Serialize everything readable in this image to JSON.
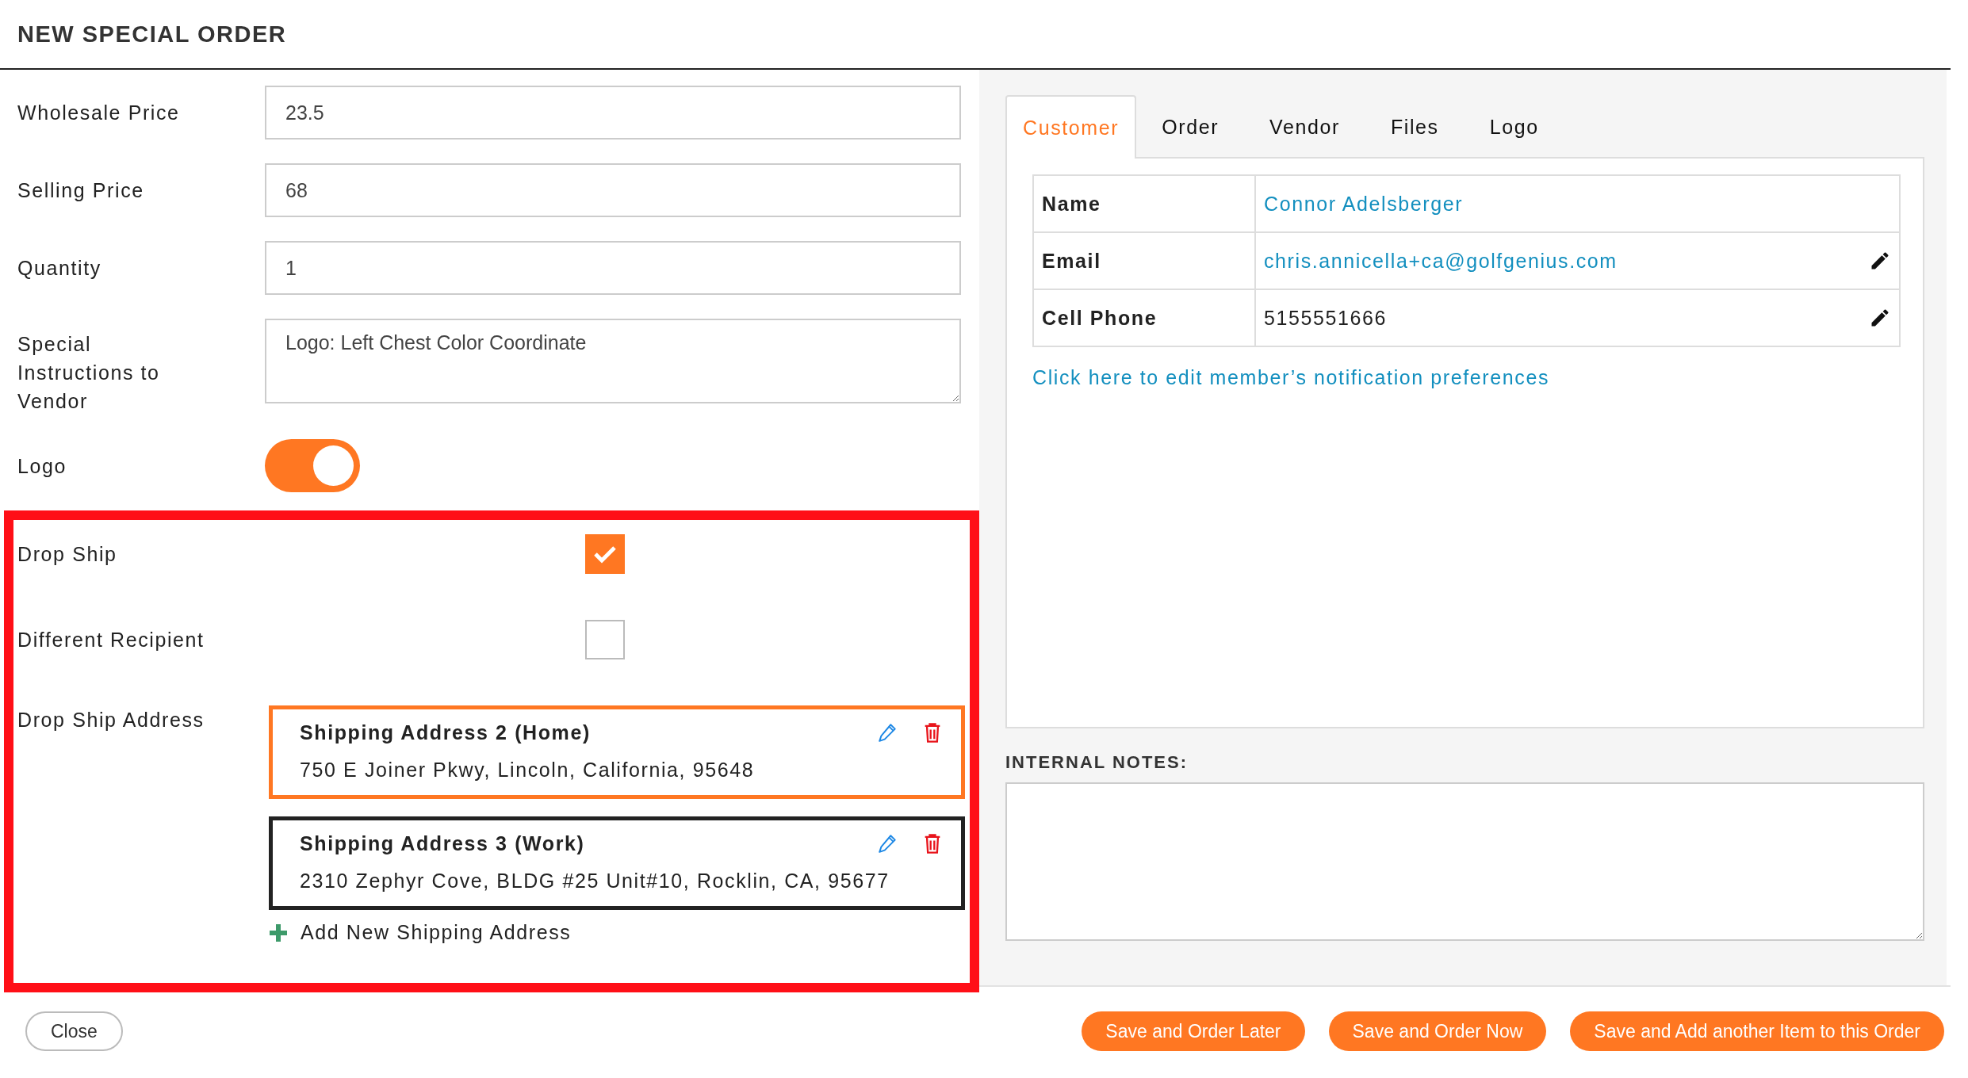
{
  "title": "NEW SPECIAL ORDER",
  "fields": [
    {
      "label": "Wholesale Price",
      "kind": "input",
      "value": "23.5"
    },
    {
      "label": "Selling Price",
      "kind": "input",
      "value": "68"
    },
    {
      "label": "Quantity",
      "kind": "input",
      "value": "1"
    },
    {
      "label": "Special Instructions to Vendor",
      "kind": "textarea",
      "value": "Logo: Left Chest Color Coordinate"
    },
    {
      "label": "Logo",
      "kind": "toggle",
      "on": true
    }
  ],
  "drop_ship": {
    "options": [
      {
        "label": "Drop Ship",
        "checked": true
      },
      {
        "label": "Different Recipient",
        "checked": false
      }
    ],
    "address_label": "Drop Ship Address",
    "addresses": [
      {
        "name": "Shipping Address 2 (Home)",
        "address": "750 E Joiner Pkwy, Lincoln, California, 95648",
        "selected": true
      },
      {
        "name": "Shipping Address 3 (Work)",
        "address": "2310 Zephyr Cove, BLDG #25 Unit#10, Rocklin, CA, 95677",
        "selected": false
      }
    ],
    "add_address": "Add New Shipping Address"
  },
  "tabs": [
    {
      "label": "Customer",
      "selected": true
    },
    {
      "label": "Order",
      "selected": false
    },
    {
      "label": "Vendor",
      "selected": false
    },
    {
      "label": "Files",
      "selected": false
    },
    {
      "label": "Logo",
      "selected": false
    }
  ],
  "customer": {
    "rows": [
      {
        "label": "Name",
        "value": "Connor Adelsberger",
        "link": true,
        "editable": false
      },
      {
        "label": "Email",
        "value": "chris.annicella+ca@golfgenius.com",
        "link": true,
        "editable": true
      },
      {
        "label": "Cell Phone",
        "value": "5155551666",
        "link": false,
        "editable": true
      }
    ],
    "preferences_link": "Click here to edit member’s notification preferences"
  },
  "internal_notes": {
    "label": "INTERNAL NOTES:"
  },
  "footer": {
    "close": "Close",
    "actions": [
      "Save and Order Later",
      "Save and Order Now",
      "Save and Add another Item to this Order"
    ]
  }
}
